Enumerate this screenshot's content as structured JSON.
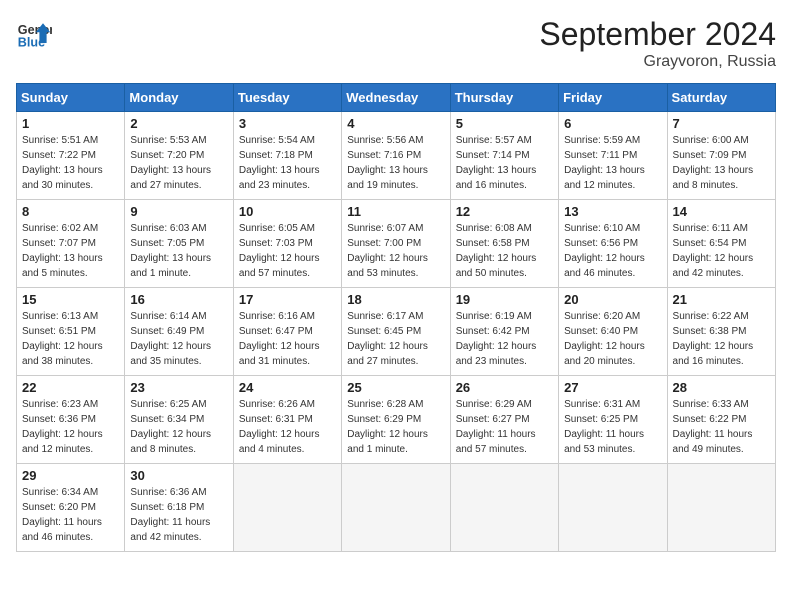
{
  "header": {
    "logo_line1": "General",
    "logo_line2": "Blue",
    "month": "September 2024",
    "location": "Grayvoron, Russia"
  },
  "days_of_week": [
    "Sunday",
    "Monday",
    "Tuesday",
    "Wednesday",
    "Thursday",
    "Friday",
    "Saturday"
  ],
  "weeks": [
    [
      {
        "num": "1",
        "sunrise": "Sunrise: 5:51 AM",
        "sunset": "Sunset: 7:22 PM",
        "daylight": "Daylight: 13 hours and 30 minutes."
      },
      {
        "num": "2",
        "sunrise": "Sunrise: 5:53 AM",
        "sunset": "Sunset: 7:20 PM",
        "daylight": "Daylight: 13 hours and 27 minutes."
      },
      {
        "num": "3",
        "sunrise": "Sunrise: 5:54 AM",
        "sunset": "Sunset: 7:18 PM",
        "daylight": "Daylight: 13 hours and 23 minutes."
      },
      {
        "num": "4",
        "sunrise": "Sunrise: 5:56 AM",
        "sunset": "Sunset: 7:16 PM",
        "daylight": "Daylight: 13 hours and 19 minutes."
      },
      {
        "num": "5",
        "sunrise": "Sunrise: 5:57 AM",
        "sunset": "Sunset: 7:14 PM",
        "daylight": "Daylight: 13 hours and 16 minutes."
      },
      {
        "num": "6",
        "sunrise": "Sunrise: 5:59 AM",
        "sunset": "Sunset: 7:11 PM",
        "daylight": "Daylight: 13 hours and 12 minutes."
      },
      {
        "num": "7",
        "sunrise": "Sunrise: 6:00 AM",
        "sunset": "Sunset: 7:09 PM",
        "daylight": "Daylight: 13 hours and 8 minutes."
      }
    ],
    [
      {
        "num": "8",
        "sunrise": "Sunrise: 6:02 AM",
        "sunset": "Sunset: 7:07 PM",
        "daylight": "Daylight: 13 hours and 5 minutes."
      },
      {
        "num": "9",
        "sunrise": "Sunrise: 6:03 AM",
        "sunset": "Sunset: 7:05 PM",
        "daylight": "Daylight: 13 hours and 1 minute."
      },
      {
        "num": "10",
        "sunrise": "Sunrise: 6:05 AM",
        "sunset": "Sunset: 7:03 PM",
        "daylight": "Daylight: 12 hours and 57 minutes."
      },
      {
        "num": "11",
        "sunrise": "Sunrise: 6:07 AM",
        "sunset": "Sunset: 7:00 PM",
        "daylight": "Daylight: 12 hours and 53 minutes."
      },
      {
        "num": "12",
        "sunrise": "Sunrise: 6:08 AM",
        "sunset": "Sunset: 6:58 PM",
        "daylight": "Daylight: 12 hours and 50 minutes."
      },
      {
        "num": "13",
        "sunrise": "Sunrise: 6:10 AM",
        "sunset": "Sunset: 6:56 PM",
        "daylight": "Daylight: 12 hours and 46 minutes."
      },
      {
        "num": "14",
        "sunrise": "Sunrise: 6:11 AM",
        "sunset": "Sunset: 6:54 PM",
        "daylight": "Daylight: 12 hours and 42 minutes."
      }
    ],
    [
      {
        "num": "15",
        "sunrise": "Sunrise: 6:13 AM",
        "sunset": "Sunset: 6:51 PM",
        "daylight": "Daylight: 12 hours and 38 minutes."
      },
      {
        "num": "16",
        "sunrise": "Sunrise: 6:14 AM",
        "sunset": "Sunset: 6:49 PM",
        "daylight": "Daylight: 12 hours and 35 minutes."
      },
      {
        "num": "17",
        "sunrise": "Sunrise: 6:16 AM",
        "sunset": "Sunset: 6:47 PM",
        "daylight": "Daylight: 12 hours and 31 minutes."
      },
      {
        "num": "18",
        "sunrise": "Sunrise: 6:17 AM",
        "sunset": "Sunset: 6:45 PM",
        "daylight": "Daylight: 12 hours and 27 minutes."
      },
      {
        "num": "19",
        "sunrise": "Sunrise: 6:19 AM",
        "sunset": "Sunset: 6:42 PM",
        "daylight": "Daylight: 12 hours and 23 minutes."
      },
      {
        "num": "20",
        "sunrise": "Sunrise: 6:20 AM",
        "sunset": "Sunset: 6:40 PM",
        "daylight": "Daylight: 12 hours and 20 minutes."
      },
      {
        "num": "21",
        "sunrise": "Sunrise: 6:22 AM",
        "sunset": "Sunset: 6:38 PM",
        "daylight": "Daylight: 12 hours and 16 minutes."
      }
    ],
    [
      {
        "num": "22",
        "sunrise": "Sunrise: 6:23 AM",
        "sunset": "Sunset: 6:36 PM",
        "daylight": "Daylight: 12 hours and 12 minutes."
      },
      {
        "num": "23",
        "sunrise": "Sunrise: 6:25 AM",
        "sunset": "Sunset: 6:34 PM",
        "daylight": "Daylight: 12 hours and 8 minutes."
      },
      {
        "num": "24",
        "sunrise": "Sunrise: 6:26 AM",
        "sunset": "Sunset: 6:31 PM",
        "daylight": "Daylight: 12 hours and 4 minutes."
      },
      {
        "num": "25",
        "sunrise": "Sunrise: 6:28 AM",
        "sunset": "Sunset: 6:29 PM",
        "daylight": "Daylight: 12 hours and 1 minute."
      },
      {
        "num": "26",
        "sunrise": "Sunrise: 6:29 AM",
        "sunset": "Sunset: 6:27 PM",
        "daylight": "Daylight: 11 hours and 57 minutes."
      },
      {
        "num": "27",
        "sunrise": "Sunrise: 6:31 AM",
        "sunset": "Sunset: 6:25 PM",
        "daylight": "Daylight: 11 hours and 53 minutes."
      },
      {
        "num": "28",
        "sunrise": "Sunrise: 6:33 AM",
        "sunset": "Sunset: 6:22 PM",
        "daylight": "Daylight: 11 hours and 49 minutes."
      }
    ],
    [
      {
        "num": "29",
        "sunrise": "Sunrise: 6:34 AM",
        "sunset": "Sunset: 6:20 PM",
        "daylight": "Daylight: 11 hours and 46 minutes."
      },
      {
        "num": "30",
        "sunrise": "Sunrise: 6:36 AM",
        "sunset": "Sunset: 6:18 PM",
        "daylight": "Daylight: 11 hours and 42 minutes."
      },
      null,
      null,
      null,
      null,
      null
    ]
  ]
}
